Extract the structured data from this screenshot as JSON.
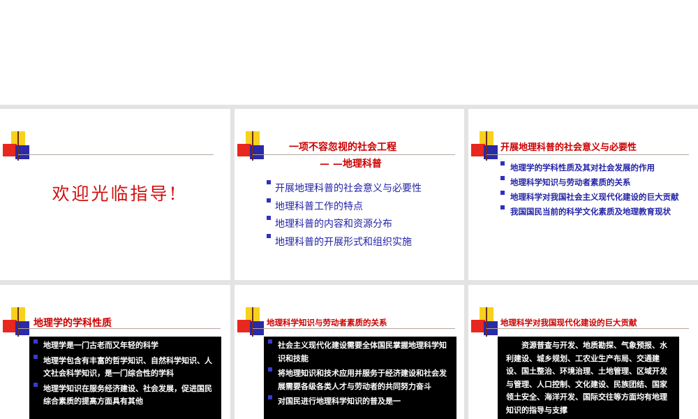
{
  "slides": {
    "s1": {
      "welcome": "欢迎光临指导!"
    },
    "s2": {
      "title": "一项不容忽视的社会工程",
      "subtitle": "— —地理科普",
      "items": [
        "开展地理科普的社会意义与必要性",
        "地理科普工作的特点",
        "地理科普的内容和资源分布",
        "地理科普的开展形式和组织实施"
      ]
    },
    "s3": {
      "title": "开展地理科普的社会意义与必要性",
      "items": [
        "地理学的学科性质及其对社会发展的作用",
        "地理科学知识与劳动者素质的关系",
        "地理科学对我国社会主义现代化建设的巨大贡献",
        "我国国民当前的科学文化素质及地理教育现状"
      ]
    },
    "s4": {
      "title": "地理学的学科性质",
      "items": [
        "地理学是一门古老而又年轻的科学",
        "地理学包含有丰富的哲学知识、自然科学知识、人文社会科学知识，是一门综合性的学科",
        "地理学知识在服务经济建设、社会发展，促进国民综合素质的提高方面具有其他"
      ]
    },
    "s5": {
      "title": "地理科学知识与劳动者素质的关系",
      "items": [
        "社会主义现代化建设需要全体国民掌握地理科学知识和技能",
        "将地理知识和技术应用并服务于经济建设和社会发展需要各级各类人才与劳动者的共同努力奋斗",
        "对国民进行地理科学知识的普及是一"
      ]
    },
    "s6": {
      "title": "地理科学对我国现代化建设的巨大贡献",
      "paragraph": "资源普查与开发、地质勘探、气象预报、水利建设、城乡规划、工农业生产布局、交通建设、国土整治、环境治理、土地管理、区域开发与管理、人口控制、文化建设、民族团结、国家领土安全、海洋开发、国际交往等方面均有地理知识的指导与支撑"
    }
  }
}
